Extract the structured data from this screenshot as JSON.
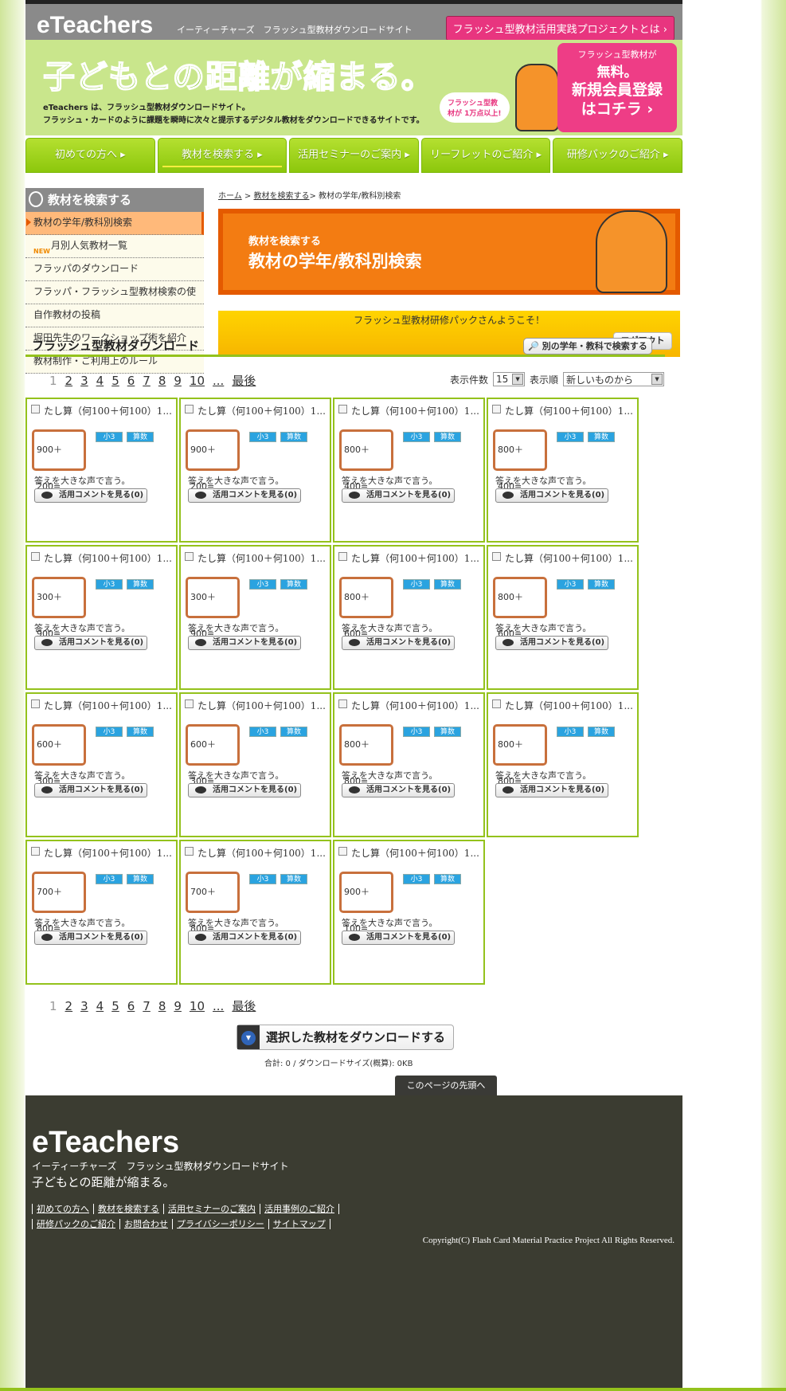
{
  "header": {
    "logo": "eTeachers",
    "tagline": "イーティーチャーズ　フラッシュ型教材ダウンロードサイト",
    "project_link": "フラッシュ型教材活用実践プロジェクトとは ›"
  },
  "hero": {
    "title": "子どもとの距離が縮まる。",
    "desc1": "eTeachers は、フラッシュ型教材ダウンロードサイト。",
    "desc2": "フラッシュ・カードのように課題を瞬時に次々と提示するデジタル教材をダウンロードできるサイトです。",
    "bubble": "フラッシュ型教材が 1万点以上!",
    "register_small": "フラッシュ型教材が",
    "register_free": "無料。",
    "register_big1": "新規会員登録",
    "register_big2": "はコチラ ›"
  },
  "nav": [
    {
      "label": "初めての方へ ▸"
    },
    {
      "label": "教材を検索する ▸"
    },
    {
      "label": "活用セミナーのご案内 ▸"
    },
    {
      "label": "リーフレットのご紹介 ▸"
    },
    {
      "label": "研修パックのご紹介 ▸"
    }
  ],
  "sidebar": {
    "title": "教材を検索する",
    "items": [
      {
        "label": "教材の学年/教科別検索"
      },
      {
        "label": "月別人気教材一覧",
        "badge": "NEW"
      },
      {
        "label": "フラッパのダウンロード"
      },
      {
        "label": "フラッパ・フラッシュ型教材検索の使い方"
      },
      {
        "label": "自作教材の投稿"
      },
      {
        "label": "堀田先生のワークショップ術を紹介"
      },
      {
        "label": "教材制作・ご利用上のルール"
      }
    ]
  },
  "section_title": "フラッシュ型教材ダウンロード",
  "breadcrumb": {
    "home": "ホーム",
    "search": "教材を検索する",
    "current": "> 教材の学年/教科別検索"
  },
  "banner": {
    "sub": "教材を検索する",
    "title": "教材の学年/教科別検索"
  },
  "welcome": {
    "text": "フラッシュ型教材研修パックさんようこそ！",
    "logout": "ログアウト"
  },
  "other_search": "別の学年・教科で検索する",
  "pager": {
    "pages": [
      "1",
      "2",
      "3",
      "4",
      "5",
      "6",
      "7",
      "8",
      "9",
      "10"
    ],
    "ellipsis": "...",
    "last": "最後"
  },
  "sort": {
    "count_label": "表示件数",
    "count_value": "15",
    "order_label": "表示順",
    "order_value": "新しいものから"
  },
  "items": [
    {
      "title": "たし算（何100＋何100）1...",
      "problem": "900＋200=",
      "grade": "小3",
      "subject": "算数",
      "desc": "答えを大きな声で言う。",
      "comment": "活用コメントを見る(0)"
    },
    {
      "title": "たし算（何100＋何100）1...",
      "problem": "900＋200=",
      "grade": "小3",
      "subject": "算数",
      "desc": "答えを大きな声で言う。",
      "comment": "活用コメントを見る(0)"
    },
    {
      "title": "たし算（何100＋何100）1...",
      "problem": "800＋400=",
      "grade": "小3",
      "subject": "算数",
      "desc": "答えを大きな声で言う。",
      "comment": "活用コメントを見る(0)"
    },
    {
      "title": "たし算（何100＋何100）1...",
      "problem": "800＋400=",
      "grade": "小3",
      "subject": "算数",
      "desc": "答えを大きな声で言う。",
      "comment": "活用コメントを見る(0)"
    },
    {
      "title": "たし算（何100＋何100）1...",
      "problem": "300＋900=",
      "grade": "小3",
      "subject": "算数",
      "desc": "答えを大きな声で言う。",
      "comment": "活用コメントを見る(0)"
    },
    {
      "title": "たし算（何100＋何100）1...",
      "problem": "300＋900=",
      "grade": "小3",
      "subject": "算数",
      "desc": "答えを大きな声で言う。",
      "comment": "活用コメントを見る(0)"
    },
    {
      "title": "たし算（何100＋何100）1...",
      "problem": "800＋600=",
      "grade": "小3",
      "subject": "算数",
      "desc": "答えを大きな声で言う。",
      "comment": "活用コメントを見る(0)"
    },
    {
      "title": "たし算（何100＋何100）1...",
      "problem": "800＋600=",
      "grade": "小3",
      "subject": "算数",
      "desc": "答えを大きな声で言う。",
      "comment": "活用コメントを見る(0)"
    },
    {
      "title": "たし算（何100＋何100）1...",
      "problem": "600＋300=",
      "grade": "小3",
      "subject": "算数",
      "desc": "答えを大きな声で言う。",
      "comment": "活用コメントを見る(0)"
    },
    {
      "title": "たし算（何100＋何100）1...",
      "problem": "600＋300=",
      "grade": "小3",
      "subject": "算数",
      "desc": "答えを大きな声で言う。",
      "comment": "活用コメントを見る(0)"
    },
    {
      "title": "たし算（何100＋何100）1...",
      "problem": "800＋800=",
      "grade": "小3",
      "subject": "算数",
      "desc": "答えを大きな声で言う。",
      "comment": "活用コメントを見る(0)"
    },
    {
      "title": "たし算（何100＋何100）1...",
      "problem": "800＋800=",
      "grade": "小3",
      "subject": "算数",
      "desc": "答えを大きな声で言う。",
      "comment": "活用コメントを見る(0)"
    },
    {
      "title": "たし算（何100＋何100）1...",
      "problem": "700＋800=",
      "grade": "小3",
      "subject": "算数",
      "desc": "答えを大きな声で言う。",
      "comment": "活用コメントを見る(0)"
    },
    {
      "title": "たし算（何100＋何100）1...",
      "problem": "700＋800=",
      "grade": "小3",
      "subject": "算数",
      "desc": "答えを大きな声で言う。",
      "comment": "活用コメントを見る(0)"
    },
    {
      "title": "たし算（何100＋何100）1...",
      "problem": "900＋100=",
      "grade": "小3",
      "subject": "算数",
      "desc": "答えを大きな声で言う。",
      "comment": "活用コメントを見る(0)"
    }
  ],
  "download_button": "選択した教材をダウンロードする",
  "total": "合計: 0 / ダウンロードサイズ(概算): 0KB",
  "to_top": "このページの先頭へ",
  "footer": {
    "logo": "eTeachers",
    "tagline": "イーティーチャーズ　フラッシュ型教材ダウンロードサイト",
    "catch": "子どもとの距離が縮まる。",
    "links1": [
      "初めての方へ",
      "教材を検索する",
      "活用セミナーのご案内",
      "活用事例のご紹介"
    ],
    "links2": [
      "研修パックのご紹介",
      "お問合わせ",
      "プライバシーポリシー",
      "サイトマップ"
    ],
    "copyright": "Copyright(C) Flash Card Material Practice Project All Rights Reserved."
  }
}
